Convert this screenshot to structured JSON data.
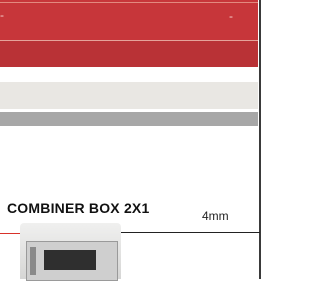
{
  "header": {
    "marks": [
      "-",
      "-"
    ]
  },
  "product": {
    "title": "COMBINER BOX 2X1",
    "dimension_label": "4mm"
  }
}
